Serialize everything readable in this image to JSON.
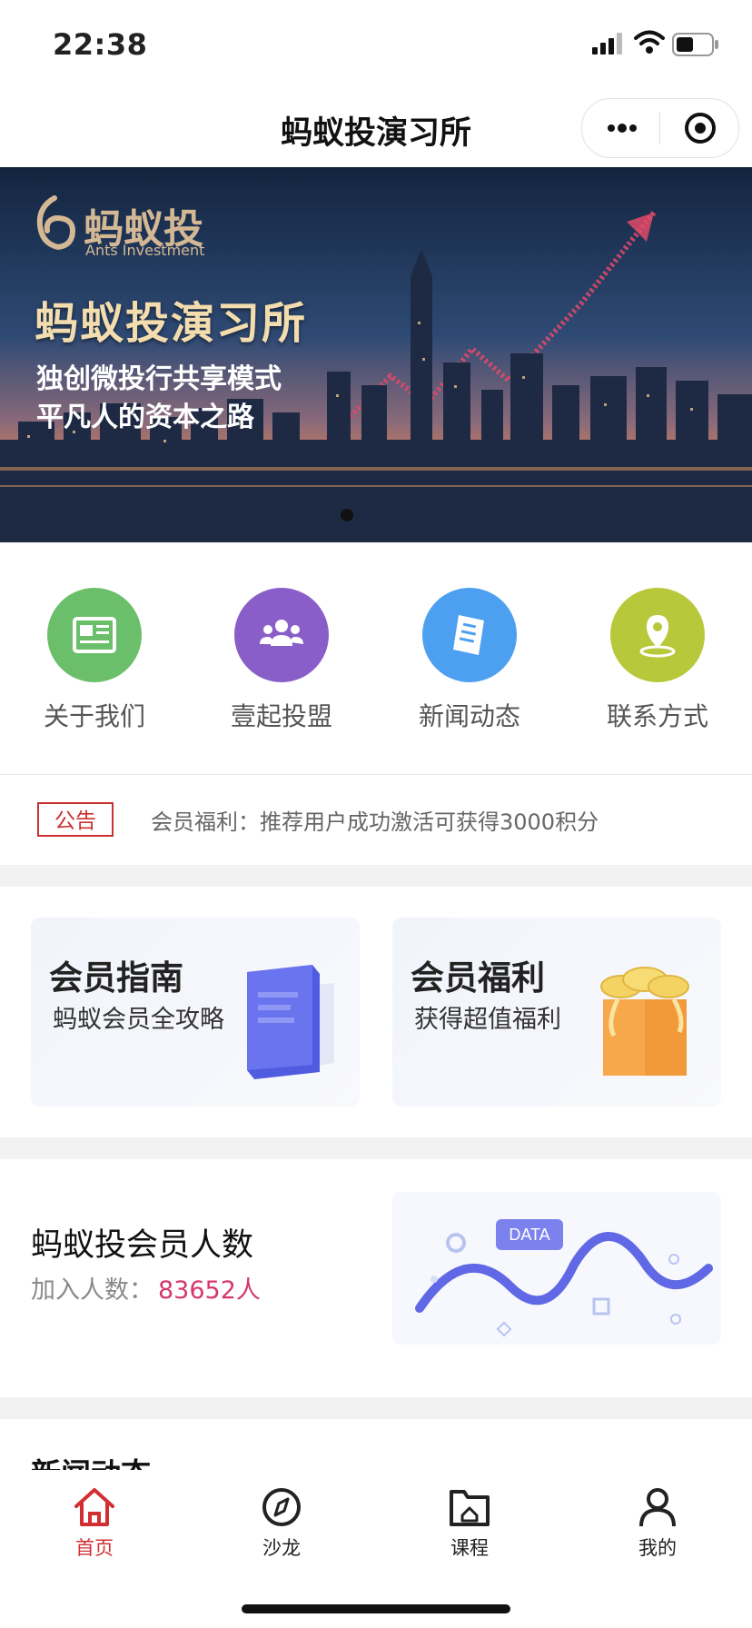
{
  "status_bar": {
    "time": "22:38"
  },
  "nav": {
    "title": "蚂蚁投演习所"
  },
  "banner": {
    "logo_text": "蚂蚁投",
    "logo_sub": "Ants Investment",
    "title": "蚂蚁投演习所",
    "line1": "独创微投行共享模式",
    "line2": "平凡人的资本之路"
  },
  "quick_links": [
    {
      "label": "关于我们",
      "icon": "newspaper-icon",
      "color": "#6cbf6a"
    },
    {
      "label": "壹起投盟",
      "icon": "group-icon",
      "color": "#8a5ec8"
    },
    {
      "label": "新闻动态",
      "icon": "document-icon",
      "color": "#4da0f0"
    },
    {
      "label": "联系方式",
      "icon": "location-pin-icon",
      "color": "#b7c93a"
    }
  ],
  "notice": {
    "tag": "公告",
    "text": "会员福利：推荐用户成功激活可获得3000积分"
  },
  "cards": [
    {
      "title": "会员指南",
      "subtitle": "蚂蚁会员全攻略",
      "icon": "book-icon"
    },
    {
      "title": "会员福利",
      "subtitle": "获得超值福利",
      "icon": "gift-box-icon"
    }
  ],
  "members": {
    "title": "蚂蚁投会员人数",
    "label": "加入人数：",
    "value": "83652人",
    "art_label": "DATA"
  },
  "news": {
    "title": "新闻动态"
  },
  "tabbar": [
    {
      "label": "首页",
      "icon": "home-icon",
      "active": true
    },
    {
      "label": "沙龙",
      "icon": "compass-icon",
      "active": false
    },
    {
      "label": "课程",
      "icon": "folder-icon",
      "active": false
    },
    {
      "label": "我的",
      "icon": "user-icon",
      "active": false
    }
  ],
  "colors": {
    "accent": "#d12f34",
    "notice_red": "#c8312f",
    "member_value": "#d4386a",
    "divider_bg": "#f2f2f2"
  }
}
